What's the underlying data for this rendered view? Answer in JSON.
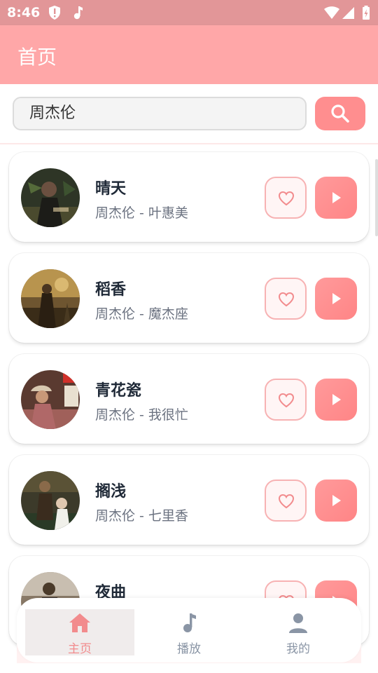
{
  "status_bar": {
    "time": "8:46"
  },
  "app_bar": {
    "title": "首页"
  },
  "search": {
    "value": "周杰伦"
  },
  "songs": [
    {
      "title": "晴天",
      "subtitle": "周杰伦 - 叶惠美"
    },
    {
      "title": "稻香",
      "subtitle": "周杰伦 - 魔杰座"
    },
    {
      "title": "青花瓷",
      "subtitle": "周杰伦 - 我很忙"
    },
    {
      "title": "搁浅",
      "subtitle": "周杰伦 - 七里香"
    },
    {
      "title": "夜曲",
      "subtitle": ""
    }
  ],
  "bottom_nav": {
    "items": [
      {
        "label": "主页",
        "icon": "home-icon",
        "active": true
      },
      {
        "label": "播放",
        "icon": "music-note-icon",
        "active": false
      },
      {
        "label": "我的",
        "icon": "person-icon",
        "active": false
      }
    ]
  },
  "colors": {
    "app_bar": "#ffa7a8",
    "status_bar": "#e29698",
    "accent": "#ff8e8f",
    "nav_active": "#f28b8d"
  }
}
